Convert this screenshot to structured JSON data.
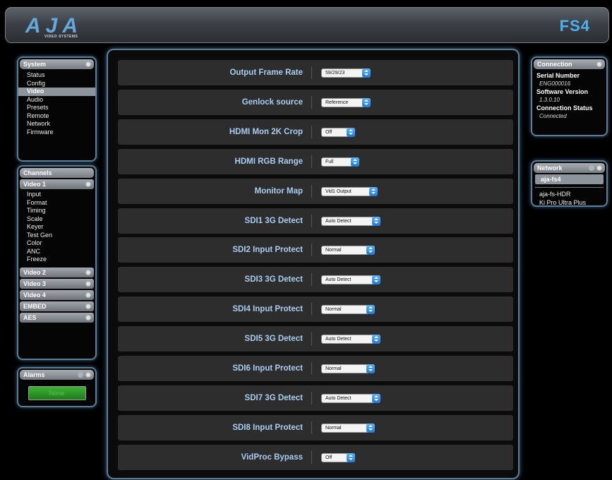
{
  "header": {
    "brand": "AJA",
    "brand_sub": "VIDEO SYSTEMS",
    "model": "FS4"
  },
  "system": {
    "title": "System",
    "items": [
      "Status",
      "Config",
      "Video",
      "Audio",
      "Presets",
      "Remote",
      "Network",
      "Firmware"
    ],
    "active": "Video"
  },
  "channels": {
    "title": "Channels",
    "video1": {
      "title": "Video 1",
      "items": [
        "Input",
        "Format",
        "Timing",
        "Scale",
        "Keyer",
        "Test Gen",
        "Color",
        "ANC",
        "Freeze"
      ]
    },
    "collapsed": [
      "Video 2",
      "Video 3",
      "Video 4",
      "EMBED",
      "AES"
    ]
  },
  "alarms": {
    "title": "Alarms",
    "status": "None"
  },
  "settings": [
    {
      "label": "Output Frame Rate",
      "value": "59/29/23"
    },
    {
      "label": "Genlock source",
      "value": "Reference"
    },
    {
      "label": "HDMI Mon 2K Crop",
      "value": "Off"
    },
    {
      "label": "HDMI RGB Range",
      "value": "Full"
    },
    {
      "label": "Monitor Map",
      "value": "Vid1 Output"
    },
    {
      "label": "SDI1 3G Detect",
      "value": "Auto Detect"
    },
    {
      "label": "SDI2 Input Protect",
      "value": "Normal"
    },
    {
      "label": "SDI3 3G Detect",
      "value": "Auto Detect"
    },
    {
      "label": "SDI4 Input Protect",
      "value": "Normal"
    },
    {
      "label": "SDI5 3G Detect",
      "value": "Auto Detect"
    },
    {
      "label": "SDI6 Input Protect",
      "value": "Normal"
    },
    {
      "label": "SDI7 3G Detect",
      "value": "Auto Detect"
    },
    {
      "label": "SDI8 Input Protect",
      "value": "Normal"
    },
    {
      "label": "VidProc Bypass",
      "value": "Off"
    }
  ],
  "connection": {
    "title": "Connection",
    "serial_label": "Serial Number",
    "serial_value": "ENG000016",
    "software_label": "Software Version",
    "software_value": "1.3.0.10",
    "status_label": "Connection Status",
    "status_value": "Connected"
  },
  "network": {
    "title": "Network",
    "current": "aja-fs4",
    "devices": [
      "aja-fs-HDR",
      "Ki Pro Ultra Plus"
    ]
  },
  "colors": {
    "accent": "#4ab2f0",
    "label": "#a9cdf0",
    "panel_glow": "#5d7d95",
    "alarm_green": "#2f9a2a"
  }
}
